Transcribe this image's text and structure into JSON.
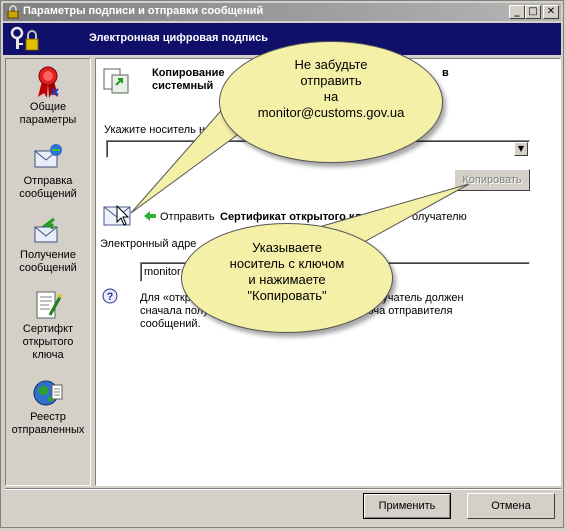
{
  "window": {
    "title": "Параметры подписи и отправки сообщений",
    "controls": {
      "minimize": "_",
      "maximize": "□",
      "close": "✕"
    }
  },
  "banner": {
    "title": "Электронная цифровая подпись"
  },
  "sidebar": {
    "items": [
      {
        "label1": "Общие",
        "label2": "параметры",
        "label3": "",
        "icon": "ribbon-medal-icon"
      },
      {
        "label1": "Отправка",
        "label2": "сообщений",
        "label3": "",
        "icon": "envelope-send-icon"
      },
      {
        "label1": "Получение",
        "label2": "сообщений",
        "label3": "",
        "icon": "envelope-receive-icon"
      },
      {
        "label1": "Сертифкт",
        "label2": "открытого",
        "label3": "ключа",
        "icon": "certificate-icon"
      },
      {
        "label1": "Реестр",
        "label2": "отправленных",
        "label3": "",
        "icon": "registry-globe-icon"
      }
    ]
  },
  "main": {
    "copy_title_line1": "Копирование",
    "copy_title_line1_end": "в",
    "copy_title_line2": "системный",
    "media_label": "Укажите носитель на кот",
    "media_select_value": "",
    "copy_button": "Копировать",
    "send_prefix": "Отправить",
    "send_bold": "Сертификат открытого кл",
    "send_suffix": "олучателю",
    "email_label": "Электронный адре",
    "email_value": "monitor@",
    "help_line1_start": "Для «откр",
    "help_line1_end": "олучатель должен",
    "help_line2_start": "сначала получ",
    "help_line2_end": "ключа отправителя",
    "help_line3": "сообщений."
  },
  "callouts": {
    "top": {
      "line1": "Не забудьте",
      "line2": "отправить",
      "line3": "на",
      "line4": "monitor@customs.gov.ua"
    },
    "bottom": {
      "line1": "Указываете",
      "line2": "носитель с ключом",
      "line3": "и нажимаете",
      "line4": "\"Копировать\""
    }
  },
  "footer": {
    "apply_button": "Применить",
    "cancel_button": "Отмена"
  },
  "colors": {
    "banner_bg": "#10106b",
    "callout_bg": "#f5f0a8",
    "window_bg": "#d4d0c8"
  }
}
